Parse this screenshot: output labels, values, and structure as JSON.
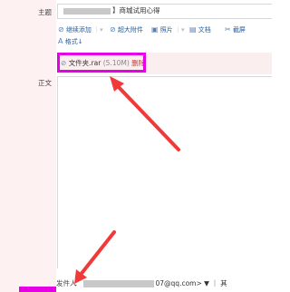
{
  "form": {
    "subject_label": "主题",
    "subject_value": "】商城试用心得",
    "body_label": "正文",
    "sender_label": "发件人",
    "sender_suffix": "07@qq.com> ▼ ｜ 其"
  },
  "toolbar": {
    "continue_add": "继续添加",
    "super_attachment": "超大附件",
    "photo": "照片",
    "document": "文档",
    "screenshot": "截屏",
    "format": "格式"
  },
  "attachment": {
    "filename": "文件夹.rar",
    "size": "(5.10M)",
    "delete": "删除"
  },
  "colors": {
    "highlight": "#e600e6",
    "arrow": "#f03a3a",
    "link": "#1f5fa6",
    "sidebar_bg": "#fdf1f1"
  },
  "icons": {
    "attachment": "paperclip-icon",
    "photo": "image-icon",
    "document": "document-icon",
    "screenshot": "scissors-icon",
    "format": "font-icon"
  }
}
